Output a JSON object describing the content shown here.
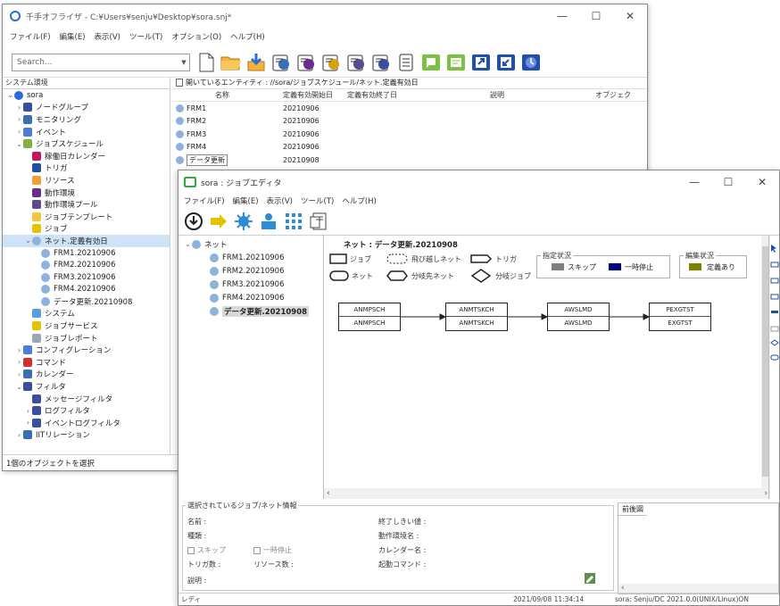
{
  "main_window": {
    "title": "千手オフライザ - C:¥Users¥senju¥Desktop¥sora.snj*",
    "controls": {
      "minimize": "—",
      "maximize": "☐",
      "close": "✕"
    },
    "menu": [
      "ファイル(F)",
      "編集(E)",
      "表示(V)",
      "ツール(T)",
      "オプション(O)",
      "ヘルプ(H)"
    ],
    "search": {
      "placeholder": "Search...",
      "value": "Search..."
    },
    "tree_header": "システム環境",
    "tree": [
      {
        "label": "sora",
        "icon": "globe-icon",
        "color": "#2b6cd6",
        "twisty": "v",
        "level": 0
      },
      {
        "label": "ノードグループ",
        "icon": "node-group-icon",
        "color": "#3b4fa0",
        "twisty": ">",
        "level": 1
      },
      {
        "label": "モニタリング",
        "icon": "monitor-icon",
        "color": "#3b6fb5",
        "twisty": ">",
        "level": 1
      },
      {
        "label": "イベント",
        "icon": "event-icon",
        "color": "#4a7fd4",
        "twisty": ">",
        "level": 1
      },
      {
        "label": "ジョブスケジュール",
        "icon": "schedule-icon",
        "color": "#7cb342",
        "twisty": "v",
        "level": 1
      },
      {
        "label": "稼働日カレンダー",
        "icon": "calendar-icon",
        "color": "#c2185b",
        "twisty": "",
        "level": 2
      },
      {
        "label": "トリガ",
        "icon": "trigger-icon",
        "color": "#1e4fa8",
        "twisty": "",
        "level": 2
      },
      {
        "label": "リソース",
        "icon": "resource-icon",
        "color": "#f0a030",
        "twisty": "",
        "level": 2
      },
      {
        "label": "動作環境",
        "icon": "environment-icon",
        "color": "#6a2c8e",
        "twisty": "",
        "level": 2
      },
      {
        "label": "動作環境プール",
        "icon": "environment-pool-icon",
        "color": "#5c4a8e",
        "twisty": "",
        "level": 2
      },
      {
        "label": "ジョブテンプレート",
        "icon": "job-template-icon",
        "color": "#f4c542",
        "twisty": "",
        "level": 2
      },
      {
        "label": "ジョブ",
        "icon": "job-icon",
        "color": "#e6c200",
        "twisty": "",
        "level": 2
      },
      {
        "label": "ネット.定義有効日",
        "icon": "net-icon",
        "color": "#8fb1de",
        "twisty": "v",
        "level": 2,
        "selected": true
      },
      {
        "label": "FRM1.20210906",
        "icon": "net-item-icon",
        "color": "#8fb1de",
        "twisty": "",
        "level": 3
      },
      {
        "label": "FRM2.20210906",
        "icon": "net-item-icon",
        "color": "#8fb1de",
        "twisty": "",
        "level": 3
      },
      {
        "label": "FRM3.20210906",
        "icon": "net-item-icon",
        "color": "#8fb1de",
        "twisty": "",
        "level": 3
      },
      {
        "label": "FRM4.20210906",
        "icon": "net-item-icon",
        "color": "#8fb1de",
        "twisty": "",
        "level": 3
      },
      {
        "label": "データ更新.20210908",
        "icon": "net-item-icon",
        "color": "#8fb1de",
        "twisty": "",
        "level": 3
      },
      {
        "label": "システム",
        "icon": "system-icon",
        "color": "#5aa0d8",
        "twisty": "",
        "level": 2
      },
      {
        "label": "ジョブサービス",
        "icon": "job-service-icon",
        "color": "#e6c200",
        "twisty": "",
        "level": 2
      },
      {
        "label": "ジョブレポート",
        "icon": "job-report-icon",
        "color": "#9aa7b5",
        "twisty": "",
        "level": 2
      },
      {
        "label": "コンフィグレーション",
        "icon": "configuration-icon",
        "color": "#4a7fd4",
        "twisty": ">",
        "level": 1
      },
      {
        "label": "コマンド",
        "icon": "command-icon",
        "color": "#d32f2f",
        "twisty": ">",
        "level": 1
      },
      {
        "label": "カレンダー",
        "icon": "calendar2-icon",
        "color": "#3b6fb5",
        "twisty": ">",
        "level": 1
      },
      {
        "label": "フィルタ",
        "icon": "filter-icon",
        "color": "#3b4fa0",
        "twisty": "v",
        "level": 1
      },
      {
        "label": "メッセージフィルタ",
        "icon": "message-filter-icon",
        "color": "#3b4fa0",
        "twisty": "",
        "level": 2
      },
      {
        "label": "ログフィルタ",
        "icon": "log-filter-icon",
        "color": "#3b4fa0",
        "twisty": ">",
        "level": 2
      },
      {
        "label": "イベントログフィルタ",
        "icon": "eventlog-filter-icon",
        "color": "#3b4fa0",
        "twisty": ">",
        "level": 2
      },
      {
        "label": "IITリレーション",
        "icon": "relation-icon",
        "color": "#3b6fb5",
        "twisty": ">",
        "level": 1
      }
    ],
    "status": "1個のオブジェクトを選択",
    "path_bar": "開いているエンティティ : //sora/ジョブスケジュール/ネット.定義有効日",
    "list_columns": [
      "名称",
      "定義有効開始日",
      "定義有効終了日",
      "説明",
      "オブジェク"
    ],
    "list_rows": [
      {
        "name": "FRM1",
        "start": "20210906"
      },
      {
        "name": "FRM2",
        "start": "20210906"
      },
      {
        "name": "FRM3",
        "start": "20210906"
      },
      {
        "name": "FRM4",
        "start": "20210906"
      },
      {
        "name": "データ更新",
        "start": "20210908"
      }
    ]
  },
  "editor_window": {
    "title": "sora : ジョブエディタ",
    "controls": {
      "minimize": "—",
      "maximize": "☐",
      "close": "✕"
    },
    "menu": [
      "ファイル(F)",
      "編集(E)",
      "表示(V)",
      "ツール(T)",
      "ヘルプ(H)"
    ],
    "tree": [
      {
        "label": "ネット",
        "twisty": "v",
        "level": 0
      },
      {
        "label": "FRM1.20210906",
        "twisty": "",
        "level": 1
      },
      {
        "label": "FRM2.20210906",
        "twisty": "",
        "level": 1
      },
      {
        "label": "FRM3.20210906",
        "twisty": "",
        "level": 1
      },
      {
        "label": "FRM4.20210906",
        "twisty": "",
        "level": 1
      },
      {
        "label": "データ更新.20210908",
        "twisty": "",
        "level": 1,
        "selected": true
      }
    ],
    "net_title": "ネット : データ更新.20210908",
    "legend": {
      "job": "ジョブ",
      "skip_net": "飛び越しネット",
      "trigger": "トリガ",
      "net": "ネット",
      "branch_net": "分岐先ネット",
      "branch_job": "分岐ジョブ"
    },
    "designation_status": {
      "title": "指定状況",
      "skip": "スキップ",
      "pause": "一時停止",
      "skip_color": "#808080",
      "pause_color": "#000080"
    },
    "edit_status": {
      "title": "編集状況",
      "defined": "定義あり",
      "defined_color": "#808000"
    },
    "jobs": [
      {
        "top": "ANMPSCH",
        "bottom": "ANMPSCH"
      },
      {
        "top": "ANMTSKCH",
        "bottom": "ANMTSKCH"
      },
      {
        "top": "AWSLMD",
        "bottom": "AWSLMD"
      },
      {
        "top": "PEXGTST",
        "bottom": "EXGTST"
      }
    ],
    "info": {
      "title": "選択されているジョブ/ネット情報",
      "name_label": "名前 :",
      "type_label": "種類 :",
      "skip_label": "スキップ",
      "pause_label": "一時停止",
      "trigger_count_label": "トリガ数 :",
      "resource_count_label": "リソース数 :",
      "description_label": "説明 :",
      "end_threshold_label": "終了しきい値 :",
      "env_name_label": "動作環境名 :",
      "calendar_name_label": "カレンダー名 :",
      "start_command_label": "起動コマンド :"
    },
    "precedence_tab": "前後図",
    "status_left": "レディ",
    "status_time": "2021/09/08 11:34:14",
    "status_right": "sora: Senju/DC 2021.0.0(UNIX/Linux)ON"
  }
}
